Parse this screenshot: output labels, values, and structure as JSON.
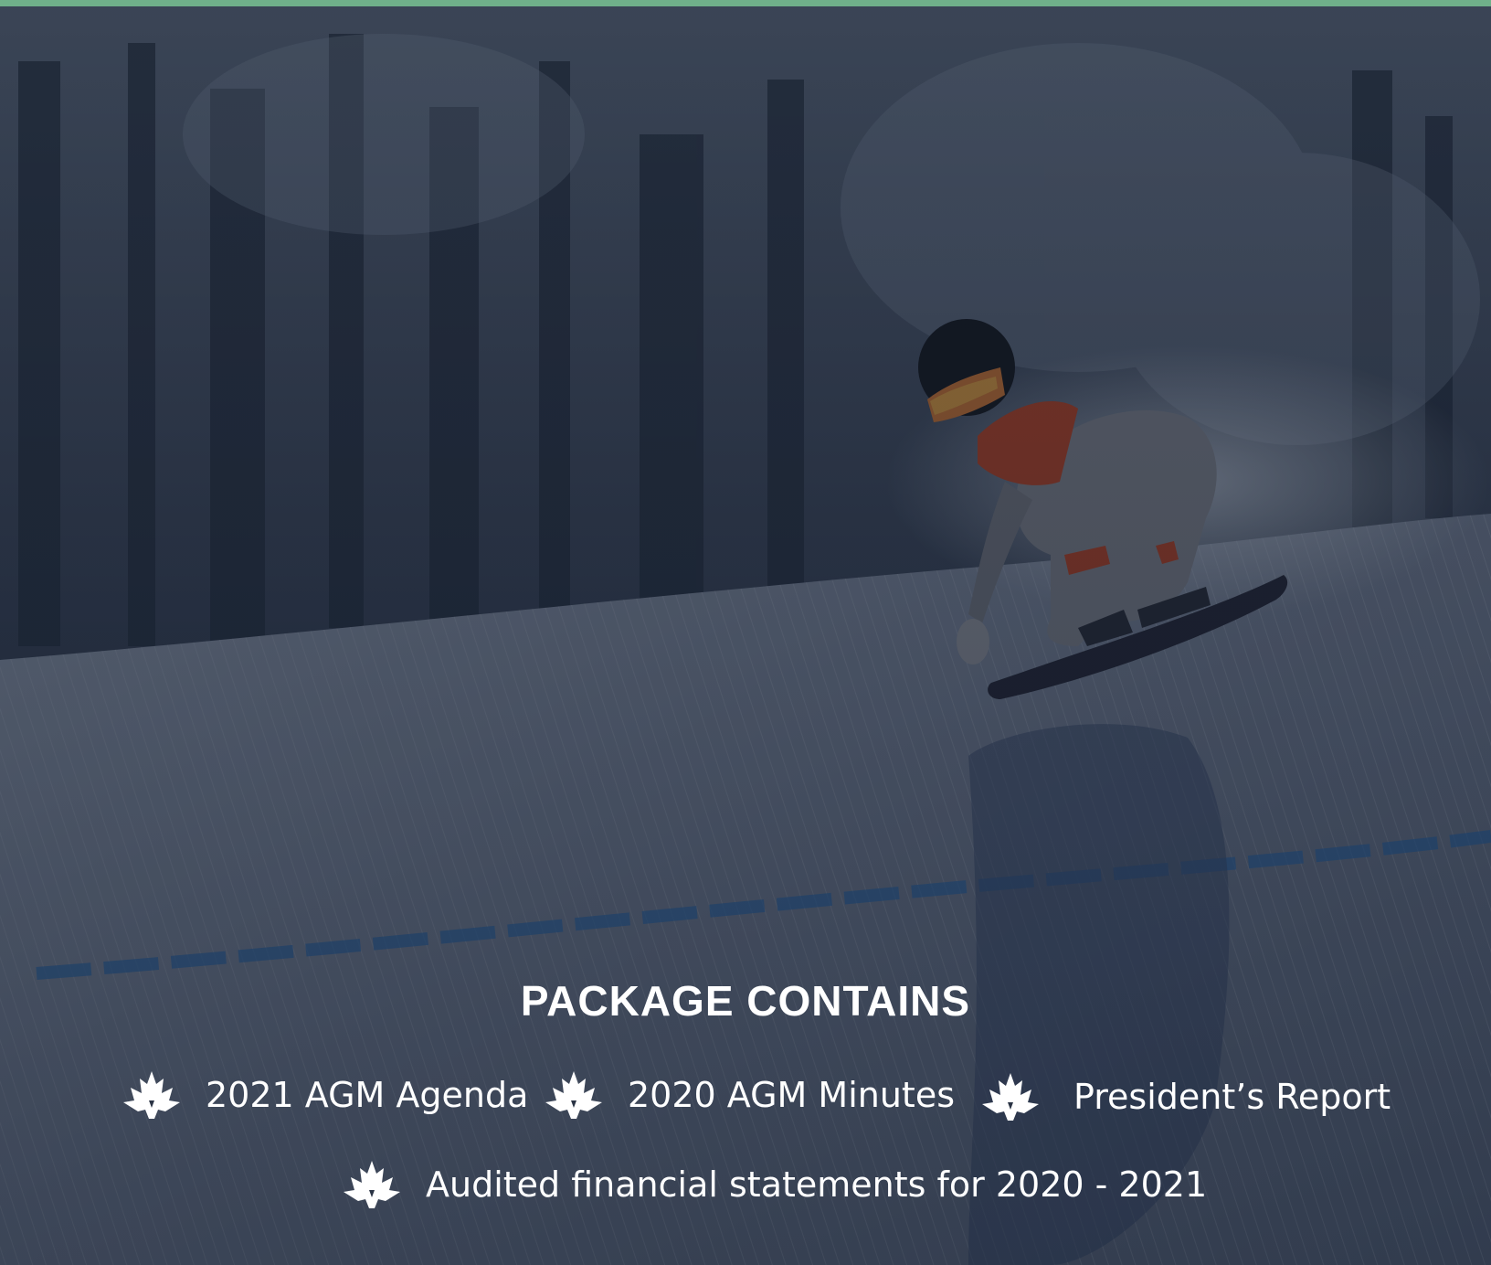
{
  "section": {
    "title": "PACKAGE CONTAINS"
  },
  "package_items": [
    {
      "label": "2021 AGM Agenda",
      "icon": "maple-leaf-icon"
    },
    {
      "label": "2020 AGM Minutes",
      "icon": "maple-leaf-icon"
    },
    {
      "label": "President’s Report",
      "icon": "maple-leaf-icon"
    },
    {
      "label": "Audited financial statements for 2020 - 2021",
      "icon": "maple-leaf-icon"
    }
  ],
  "colors": {
    "accent_bar": "#6fb08a",
    "text": "#ffffff",
    "overlay": "#0f1a2c"
  }
}
